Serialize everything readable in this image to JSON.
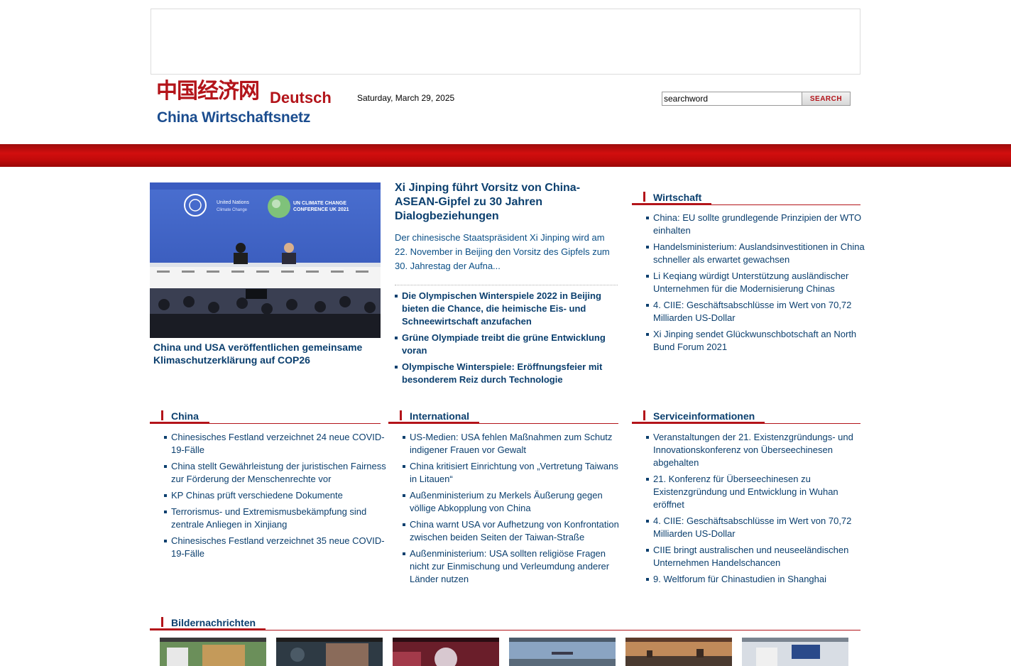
{
  "header": {
    "logo_cn": "中国经济网",
    "logo_lang": "Deutsch",
    "logo_en": "China Wirtschaftsnetz",
    "date": "Saturday, March 29, 2025",
    "search_value": "searchword",
    "search_button": "SEARCH"
  },
  "top_story": {
    "image_text_1": "United Nations",
    "image_text_2": "Climate Change",
    "image_text_3": "UN CLIMATE CHANGE",
    "image_text_4": "CONFERENCE UK 2021",
    "caption": "China und USA veröffentlichen gemeinsame Klimaschutzerklärung auf COP26"
  },
  "lead": {
    "headline": "Xi Jinping führt Vorsitz von China-ASEAN-Gipfel zu 30 Jahren Dialogbeziehungen",
    "summary": "Der chinesische Staatspräsident Xi Jinping wird am 22. November in Beijing den Vorsitz des Gipfels zum 30. Jahrestag der Aufna...",
    "items": [
      "Die Olympischen Winterspiele 2022 in Beijing bieten die Chance, die heimische Eis- und Schneewirtschaft anzufachen",
      "Grüne Olympiade treibt die grüne Entwicklung voran",
      "Olympische Winterspiele: Eröffnungsfeier mit besonderem Reiz durch Technologie"
    ]
  },
  "wirtschaft": {
    "title": "Wirtschaft",
    "items": [
      "China: EU sollte grundlegende Prinzipien der WTO einhalten",
      "Handelsministerium: Auslandsinvestitionen in China schneller als erwartet gewachsen",
      "Li Keqiang würdigt Unterstützung ausländischer Unternehmen für die Modernisierung Chinas",
      "4. CIIE: Geschäftsabschlüsse im Wert von 70,72 Milliarden US-Dollar",
      "Xi Jinping sendet Glückwunschbotschaft an North Bund Forum 2021"
    ]
  },
  "china": {
    "title": "China",
    "items": [
      "Chinesisches Festland verzeichnet 24 neue COVID-19-Fälle",
      "China stellt Gewährleistung der juristischen Fairness zur Förderung der Menschenrechte vor",
      "KP Chinas prüft verschiedene Dokumente",
      "Terrorismus- und Extremismusbekämpfung sind zentrale Anliegen in Xinjiang",
      "Chinesisches Festland verzeichnet 35 neue COVID-19-Fälle"
    ]
  },
  "international": {
    "title": "International",
    "items": [
      "US-Medien: USA fehlen Maßnahmen zum Schutz indigener Frauen vor Gewalt",
      "China kritisiert Einrichtung von „Vertretung Taiwans in Litauen“",
      "Außenministerium zu Merkels Äußerung gegen völlige Abkopplung von China",
      "China warnt USA vor Aufhetzung von Konfrontation zwischen beiden Seiten der Taiwan-Straße",
      "Außenministerium: USA sollten religiöse Fragen nicht zur Einmischung und Verleumdung anderer Länder nutzen"
    ]
  },
  "service": {
    "title": "Serviceinformationen",
    "items": [
      "Veranstaltungen der 21. Existenzgründungs- und Innovationskonferenz von Überseechinesen abgehalten",
      "21. Konferenz für Überseechinesen zu Existenzgründung und Entwicklung in Wuhan eröffnet",
      "4. CIIE: Geschäftsabschlüsse im Wert von 70,72 Milliarden US-Dollar",
      "CIIE bringt australischen und neuseeländischen Unternehmen Handelschancen",
      "9. Weltforum für Chinastudien in Shanghai"
    ]
  },
  "bilder": {
    "title": "Bildernachrichten"
  }
}
